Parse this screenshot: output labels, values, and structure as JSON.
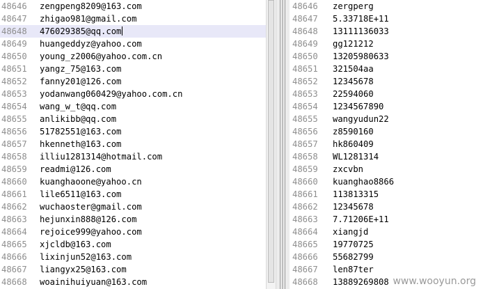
{
  "left_pane": {
    "lines": [
      {
        "num": "48646",
        "text": "zengpeng8209@163.com"
      },
      {
        "num": "48647",
        "text": "zhigao981@gmail.com"
      },
      {
        "num": "48648",
        "text": "476029385@qq.com"
      },
      {
        "num": "48649",
        "text": "huangeddyz@yahoo.com"
      },
      {
        "num": "48650",
        "text": "young_z2006@yahoo.com.cn"
      },
      {
        "num": "48651",
        "text": "yangz_75@163.com"
      },
      {
        "num": "48652",
        "text": "fanny201@126.com"
      },
      {
        "num": "48653",
        "text": "yodanwang060429@yahoo.com.cn"
      },
      {
        "num": "48654",
        "text": "wang_w_t@qq.com"
      },
      {
        "num": "48655",
        "text": "anlikibb@qq.com"
      },
      {
        "num": "48656",
        "text": "51782551@163.com"
      },
      {
        "num": "48657",
        "text": "hkenneth@163.com"
      },
      {
        "num": "48658",
        "text": "illiu1281314@hotmail.com"
      },
      {
        "num": "48659",
        "text": "readmi@126.com"
      },
      {
        "num": "48660",
        "text": "kuanghaoone@yahoo.cn"
      },
      {
        "num": "48661",
        "text": "lile6511@163.com"
      },
      {
        "num": "48662",
        "text": "wuchaoster@gmail.com"
      },
      {
        "num": "48663",
        "text": "hejunxin888@126.com"
      },
      {
        "num": "48664",
        "text": "rejoice999@yahoo.com"
      },
      {
        "num": "48665",
        "text": "xjcldb@163.com"
      },
      {
        "num": "48666",
        "text": "lixinjun52@163.com"
      },
      {
        "num": "48667",
        "text": "liangyx25@163.com"
      },
      {
        "num": "48668",
        "text": "woainihuiyuan@163.com"
      }
    ],
    "current_line_index": 2
  },
  "right_pane": {
    "lines": [
      {
        "num": "48646",
        "text": "zergperg"
      },
      {
        "num": "48647",
        "text": "5.33718E+11"
      },
      {
        "num": "48648",
        "text": "13111136033"
      },
      {
        "num": "48649",
        "text": "gg121212"
      },
      {
        "num": "48650",
        "text": "13205980633"
      },
      {
        "num": "48651",
        "text": "321504aa"
      },
      {
        "num": "48652",
        "text": "12345678"
      },
      {
        "num": "48653",
        "text": "22594060"
      },
      {
        "num": "48654",
        "text": "1234567890"
      },
      {
        "num": "48655",
        "text": "wangyudun22"
      },
      {
        "num": "48656",
        "text": "z8590160"
      },
      {
        "num": "48657",
        "text": "hk860409"
      },
      {
        "num": "48658",
        "text": "WL1281314"
      },
      {
        "num": "48659",
        "text": "zxcvbn"
      },
      {
        "num": "48660",
        "text": "kuanghao8866"
      },
      {
        "num": "48661",
        "text": "113813315"
      },
      {
        "num": "48662",
        "text": "12345678"
      },
      {
        "num": "48663",
        "text": "7.71206E+11"
      },
      {
        "num": "48664",
        "text": "xiangjd"
      },
      {
        "num": "48665",
        "text": "19770725"
      },
      {
        "num": "48666",
        "text": "55682799"
      },
      {
        "num": "48667",
        "text": "len87ter"
      },
      {
        "num": "48668",
        "text": "13889269808"
      }
    ]
  },
  "watermark": "www.wooyun.org"
}
